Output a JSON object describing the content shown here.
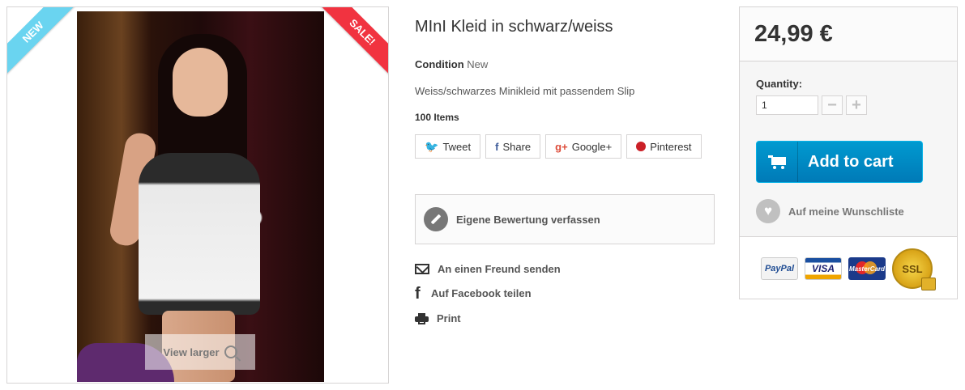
{
  "image": {
    "ribbon_new": "NEW",
    "ribbon_sale": "SALE!",
    "view_larger": "View larger"
  },
  "product": {
    "title": "MInI Kleid in schwarz/weiss",
    "condition_label": "Condition",
    "condition_value": "New",
    "description": "Weiss/schwarzes Minikleid mit passendem Slip",
    "stock": "100 Items"
  },
  "social": {
    "tweet": "Tweet",
    "share": "Share",
    "googleplus": "Google+",
    "pinterest": "Pinterest"
  },
  "review": {
    "label": "Eigene Bewertung verfassen"
  },
  "links": {
    "send_friend": "An einen Freund senden",
    "facebook_share": "Auf Facebook teilen",
    "print": "Print"
  },
  "buy": {
    "price": "24,99 €",
    "quantity_label": "Quantity:",
    "quantity_value": "1",
    "add_to_cart": "Add to cart",
    "wishlist": "Auf meine Wunschliste"
  },
  "payment": {
    "paypal": "PayPal",
    "visa": "VISA",
    "mastercard": "MasterCard",
    "ssl": "SSL"
  },
  "colors": {
    "accent_blue": "#009ad0",
    "new_ribbon": "#6ad4f0",
    "sale_ribbon": "#f13340"
  }
}
